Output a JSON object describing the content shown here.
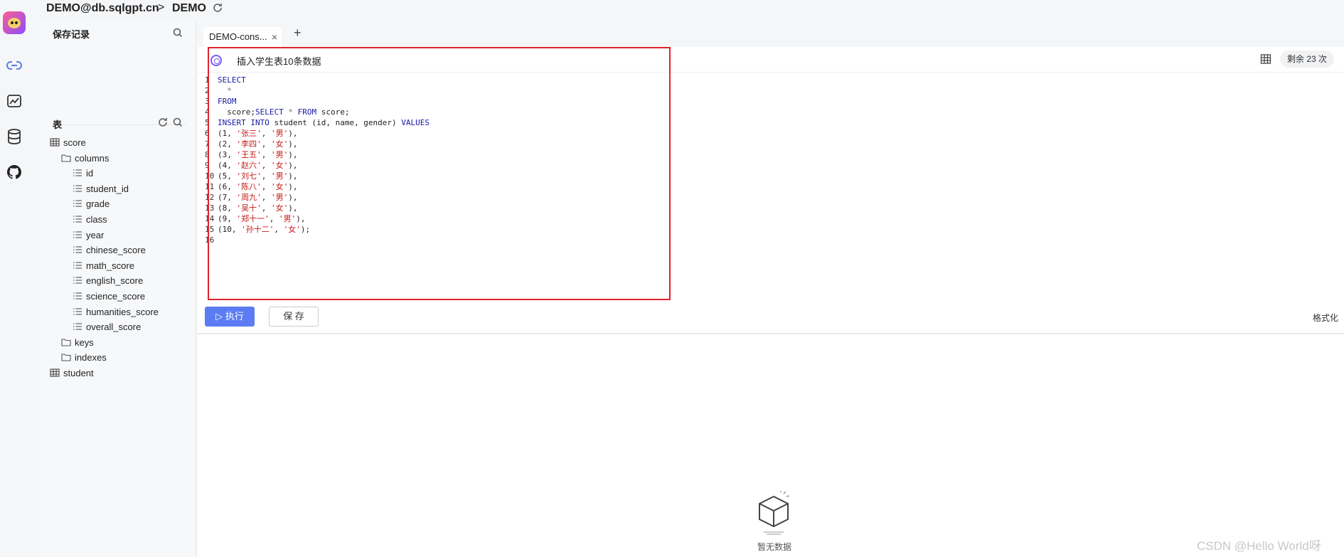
{
  "rail": {
    "icons": [
      "logo-icon",
      "link-icon",
      "chart-icon",
      "database-icon",
      "github-icon"
    ]
  },
  "header": {
    "host": "DEMO@db.sqlgpt.cn",
    "separator": ">",
    "database": "DEMO"
  },
  "sidebar": {
    "saved_title": "保存记录",
    "tables_title": "表",
    "tree": [
      {
        "label": "score",
        "type": "table"
      },
      {
        "label": "columns",
        "type": "folder"
      },
      {
        "label": "id",
        "type": "column"
      },
      {
        "label": "student_id",
        "type": "column"
      },
      {
        "label": "grade",
        "type": "column"
      },
      {
        "label": "class",
        "type": "column"
      },
      {
        "label": "year",
        "type": "column"
      },
      {
        "label": "chinese_score",
        "type": "column"
      },
      {
        "label": "math_score",
        "type": "column"
      },
      {
        "label": "english_score",
        "type": "column"
      },
      {
        "label": "science_score",
        "type": "column"
      },
      {
        "label": "humanities_score",
        "type": "column"
      },
      {
        "label": "overall_score",
        "type": "column"
      },
      {
        "label": "keys",
        "type": "folder"
      },
      {
        "label": "indexes",
        "type": "folder"
      },
      {
        "label": "student",
        "type": "table"
      }
    ]
  },
  "tabs": [
    {
      "label": "DEMO-cons...",
      "close": "×"
    }
  ],
  "tab_add": "+",
  "toolbar": {
    "prompt": "插入学生表10条数据",
    "remaining": "剩余 23 次"
  },
  "editor": {
    "lines": [
      {
        "n": "1",
        "parts": [
          [
            "kw",
            "SELECT"
          ]
        ]
      },
      {
        "n": "2",
        "parts": [
          [
            "op",
            "  *"
          ]
        ]
      },
      {
        "n": "3",
        "parts": [
          [
            "kw",
            "FROM"
          ]
        ]
      },
      {
        "n": "4",
        "parts": [
          [
            "",
            "  score;"
          ],
          [
            "kw",
            "SELECT"
          ],
          [
            "op",
            " * "
          ],
          [
            "kw",
            "FROM"
          ],
          [
            "",
            " score;"
          ]
        ]
      },
      {
        "n": "5",
        "parts": [
          [
            "kw",
            "INSERT INTO"
          ],
          [
            "",
            " student (id, name, gender) "
          ],
          [
            "kw",
            "VALUES"
          ]
        ]
      },
      {
        "n": "6",
        "parts": [
          [
            "",
            "(1, "
          ],
          [
            "str",
            "'张三'"
          ],
          [
            "",
            ", "
          ],
          [
            "str",
            "'男'"
          ],
          [
            "",
            "),"
          ]
        ]
      },
      {
        "n": "7",
        "parts": [
          [
            "",
            "(2, "
          ],
          [
            "str",
            "'李四'"
          ],
          [
            "",
            ", "
          ],
          [
            "str",
            "'女'"
          ],
          [
            "",
            "),"
          ]
        ]
      },
      {
        "n": "8",
        "parts": [
          [
            "",
            "(3, "
          ],
          [
            "str",
            "'王五'"
          ],
          [
            "",
            ", "
          ],
          [
            "str",
            "'男'"
          ],
          [
            "",
            "),"
          ]
        ]
      },
      {
        "n": "9",
        "parts": [
          [
            "",
            "(4, "
          ],
          [
            "str",
            "'赵六'"
          ],
          [
            "",
            ", "
          ],
          [
            "str",
            "'女'"
          ],
          [
            "",
            "),"
          ]
        ]
      },
      {
        "n": "10",
        "parts": [
          [
            "",
            "(5, "
          ],
          [
            "str",
            "'刘七'"
          ],
          [
            "",
            ", "
          ],
          [
            "str",
            "'男'"
          ],
          [
            "",
            "),"
          ]
        ]
      },
      {
        "n": "11",
        "parts": [
          [
            "",
            "(6, "
          ],
          [
            "str",
            "'陈八'"
          ],
          [
            "",
            ", "
          ],
          [
            "str",
            "'女'"
          ],
          [
            "",
            "),"
          ]
        ]
      },
      {
        "n": "12",
        "parts": [
          [
            "",
            "(7, "
          ],
          [
            "str",
            "'周九'"
          ],
          [
            "",
            ", "
          ],
          [
            "str",
            "'男'"
          ],
          [
            "",
            "),"
          ]
        ]
      },
      {
        "n": "13",
        "parts": [
          [
            "",
            "(8, "
          ],
          [
            "str",
            "'吴十'"
          ],
          [
            "",
            ", "
          ],
          [
            "str",
            "'女'"
          ],
          [
            "",
            "),"
          ]
        ]
      },
      {
        "n": "14",
        "parts": [
          [
            "",
            "(9, "
          ],
          [
            "str",
            "'郑十一'"
          ],
          [
            "",
            ", "
          ],
          [
            "str",
            "'男'"
          ],
          [
            "",
            "),"
          ]
        ]
      },
      {
        "n": "15",
        "parts": [
          [
            "",
            "(10, "
          ],
          [
            "str",
            "'孙十二'"
          ],
          [
            "",
            ", "
          ],
          [
            "str",
            "'女'"
          ],
          [
            "",
            ");"
          ]
        ]
      },
      {
        "n": "16",
        "parts": []
      }
    ]
  },
  "actions": {
    "run_label": "执行",
    "save_label": "保 存",
    "format_label": "格式化"
  },
  "result": {
    "empty_label": "暂无数据"
  },
  "watermark": "CSDN @Hello World呀",
  "colors": {
    "accent": "#5b7cf2",
    "highlight_box": "#e0232e",
    "keyword": "#1a1aa6",
    "string": "#c41a16"
  }
}
